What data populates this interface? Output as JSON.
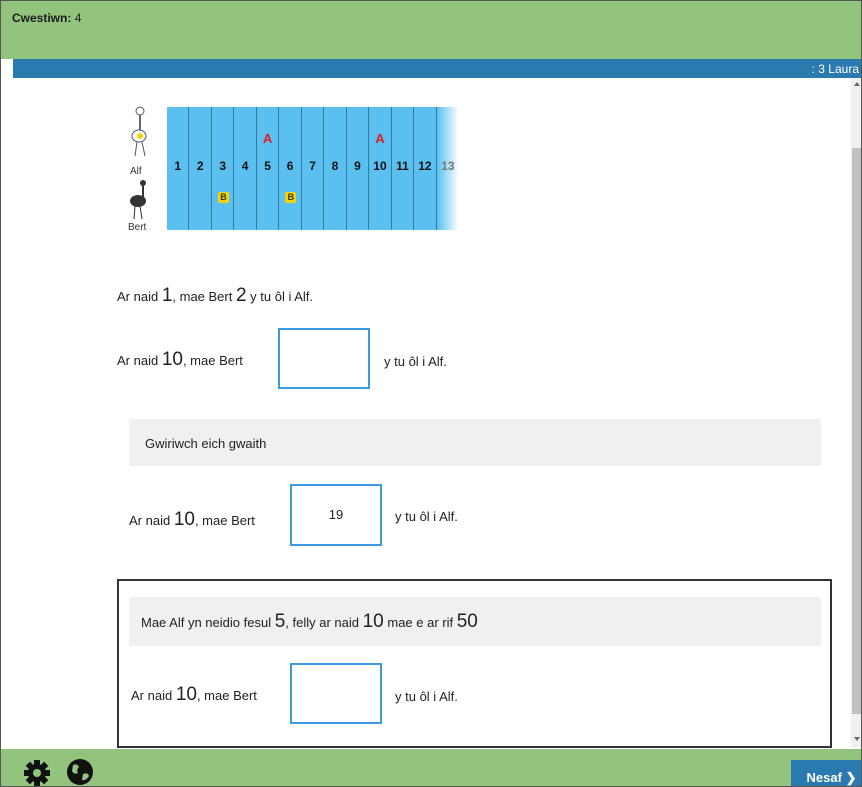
{
  "header": {
    "question_label": "Cwestiwn:",
    "question_number": "4"
  },
  "studentbar": {
    "name": ": 3 Laura"
  },
  "image": {
    "alf_label": "Alf",
    "bert_label": "Bert",
    "lanes": [
      "1",
      "2",
      "3",
      "4",
      "5",
      "6",
      "7",
      "8",
      "9",
      "10",
      "11",
      "12",
      "13"
    ],
    "a_marker": "A",
    "b_marker": "B"
  },
  "question": {
    "example": {
      "pre": "Ar naid ",
      "n1": "1",
      "mid": ", mae Bert ",
      "n2": "2",
      "post": " y tu ôl i Alf."
    },
    "ask": {
      "pre": "Ar naid ",
      "n": "10",
      "mid": ", mae Bert",
      "post": "y tu ôl i Alf.",
      "value": ""
    }
  },
  "feedback": {
    "check_label": "Gwiriwch eich gwaith",
    "answer": {
      "pre": "Ar naid ",
      "n": "10",
      "mid": ", mae Bert",
      "value": "19",
      "post": "y tu ôl i Alf."
    }
  },
  "hint": {
    "text": {
      "p1": "Mae Alf yn neidio fesul ",
      "n1": "5",
      "p2": ", felly ar naid ",
      "n2": "10",
      "p3": " mae e ar rif ",
      "n3": "50"
    },
    "ask": {
      "pre": "Ar naid ",
      "n": "10",
      "mid": ", mae Bert",
      "post": "y tu ôl i Alf.",
      "value": ""
    }
  },
  "footer": {
    "next_label": "Nesaf"
  },
  "icons": {
    "settings": "gear-icon",
    "language": "globe-icon",
    "next": "chevron-right-icon"
  },
  "colors": {
    "green": "#93c47d",
    "blue": "#2a7ab0",
    "input_border": "#3a9be0",
    "lane": "#5bbff0"
  }
}
